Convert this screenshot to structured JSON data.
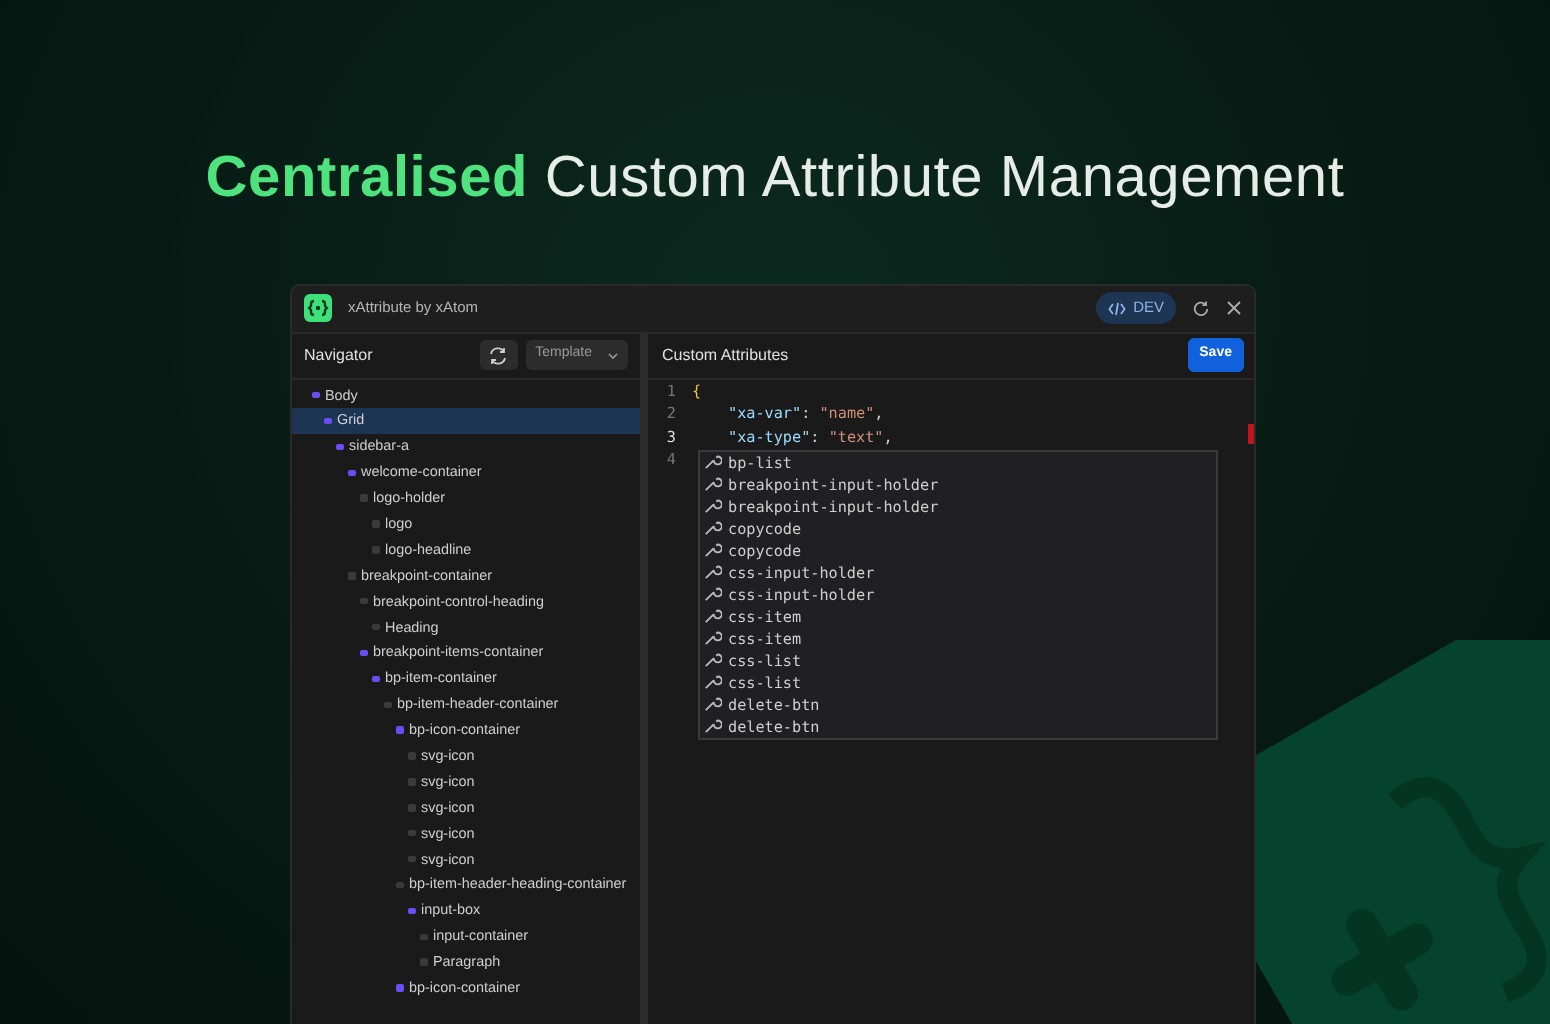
{
  "headline": "**Centralised** Custom Attribute Management",
  "window": {
    "title": "xAttribute by xAtom",
    "badge": "DEV"
  },
  "navigator": {
    "title": "Navigator",
    "template_select": "Template",
    "tree": [
      {
        "label": "Body",
        "color": "#6a4cf5",
        "selected": false,
        "children": [
          {
            "label": "Grid",
            "color": "#6a4cf5",
            "selected": true,
            "children": [
              {
                "label": "sidebar-a",
                "color": "#6a4cf5",
                "selected": false,
                "children": [
                  {
                    "label": "welcome-container",
                    "color": "#6a4cf5",
                    "selected": false,
                    "children": [
                      {
                        "label": "logo-holder",
                        "color": "#3a3a3a",
                        "selected": false,
                        "children": [
                          {
                            "label": "logo",
                            "color": "#3a3a3a",
                            "selected": false
                          },
                          {
                            "label": "logo-headline",
                            "color": "#3a3a3a",
                            "selected": false
                          }
                        ]
                      }
                    ]
                  },
                  {
                    "label": "breakpoint-container",
                    "color": "#3a3a3a",
                    "selected": false,
                    "children": [
                      {
                        "label": "breakpoint-control-heading",
                        "color": "#3a3a3a",
                        "selected": false,
                        "children": [
                          {
                            "label": "Heading",
                            "color": "#3a3a3a",
                            "selected": false
                          }
                        ]
                      },
                      {
                        "label": "breakpoint-items-container",
                        "color": "#6a4cf5",
                        "selected": false,
                        "children": [
                          {
                            "label": "bp-item-container",
                            "color": "#6a4cf5",
                            "selected": false,
                            "children": [
                              {
                                "label": "bp-item-header-container",
                                "color": "#3a3a3a",
                                "selected": false,
                                "children": [
                                  {
                                    "label": "bp-icon-container",
                                    "color": "#6a4cf5",
                                    "selected": false,
                                    "children": [
                                      {
                                        "label": "svg-icon",
                                        "color": "#3a3a3a",
                                        "selected": false
                                      },
                                      {
                                        "label": "svg-icon",
                                        "color": "#3a3a3a",
                                        "selected": false
                                      },
                                      {
                                        "label": "svg-icon",
                                        "color": "#3a3a3a",
                                        "selected": false
                                      },
                                      {
                                        "label": "svg-icon",
                                        "color": "#3a3a3a",
                                        "selected": false
                                      },
                                      {
                                        "label": "svg-icon",
                                        "color": "#3a3a3a",
                                        "selected": false
                                      }
                                    ]
                                  },
                                  {
                                    "label": "bp-item-header-heading-container",
                                    "color": "#3a3a3a",
                                    "selected": false,
                                    "children": [
                                      {
                                        "label": "input-box",
                                        "color": "#6a4cf5",
                                        "selected": false,
                                        "children": [
                                          {
                                            "label": "input-container",
                                            "color": "#3a3a3a",
                                            "selected": false
                                          },
                                          {
                                            "label": "Paragraph",
                                            "color": "#3a3a3a",
                                            "selected": false
                                          }
                                        ]
                                      }
                                    ]
                                  },
                                  {
                                    "label": "bp-icon-container",
                                    "color": "#6a4cf5",
                                    "selected": false
                                  }
                                ]
                              }
                            ]
                          }
                        ]
                      }
                    ]
                  }
                ]
              }
            ]
          }
        ]
      }
    ]
  },
  "editor": {
    "title": "Custom Attributes",
    "save_button": "Save",
    "lines": [
      {
        "number": "1",
        "tokens": [
          {
            "kind": "brace",
            "text": "{"
          }
        ]
      },
      {
        "number": "2",
        "tokens": [
          {
            "kind": "key",
            "text": "\"xa-var\""
          },
          {
            "kind": "punct",
            "text": ": "
          },
          {
            "kind": "string",
            "text": "\"name\""
          },
          {
            "kind": "punct",
            "text": ","
          }
        ]
      },
      {
        "number": "3",
        "tokens": [
          {
            "kind": "key",
            "text": "\"xa-type\""
          },
          {
            "kind": "punct",
            "text": ": "
          },
          {
            "kind": "string",
            "text": "\"text\""
          },
          {
            "kind": "punct",
            "text": ","
          }
        ]
      },
      {
        "number": "4"
      }
    ],
    "suggestions": [
      "bp-list",
      "breakpoint-input-holder",
      "breakpoint-input-holder",
      "copycode",
      "copycode",
      "css-input-holder",
      "css-input-holder",
      "css-item",
      "css-item",
      "css-list",
      "css-list",
      "delete-btn",
      "delete-btn"
    ]
  }
}
